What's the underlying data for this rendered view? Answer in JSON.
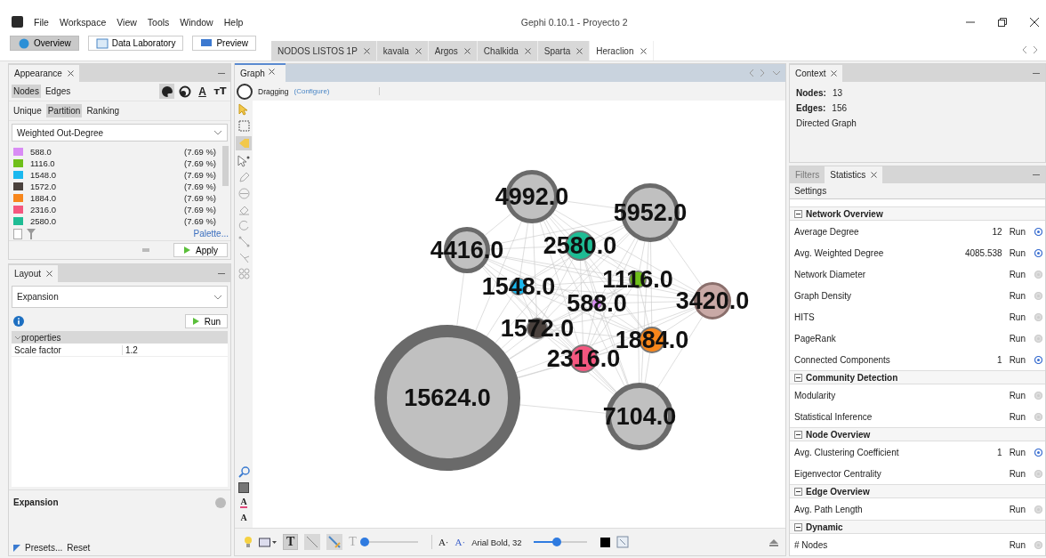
{
  "window": {
    "title": "Gephi 0.10.1 - Proyecto 2"
  },
  "menu": [
    "File",
    "Workspace",
    "View",
    "Tools",
    "Window",
    "Help"
  ],
  "perspectives": [
    {
      "label": "Overview",
      "selected": true
    },
    {
      "label": "Data Laboratory",
      "selected": false
    },
    {
      "label": "Preview",
      "selected": false
    }
  ],
  "workspaces": [
    {
      "label": "NODOS LISTOS 1P",
      "selected": false
    },
    {
      "label": "kavala",
      "selected": false
    },
    {
      "label": "Argos",
      "selected": false
    },
    {
      "label": "Chalkida",
      "selected": false
    },
    {
      "label": "Sparta",
      "selected": false
    },
    {
      "label": "Heraclion",
      "selected": true
    }
  ],
  "appearance": {
    "title": "Appearance",
    "element_tabs": [
      {
        "label": "Nodes",
        "selected": true
      },
      {
        "label": "Edges",
        "selected": false
      }
    ],
    "mode_tabs": [
      {
        "kind": "color",
        "selected": true
      },
      {
        "kind": "size",
        "selected": false
      },
      {
        "kind": "label_color",
        "label": "A",
        "selected": false
      },
      {
        "kind": "label_size",
        "label": "ᴛT",
        "selected": false
      }
    ],
    "method_tabs": [
      {
        "label": "Unique",
        "selected": false
      },
      {
        "label": "Partition",
        "selected": true
      },
      {
        "label": "Ranking",
        "selected": false
      }
    ],
    "attribute": "Weighted Out-Degree",
    "partitions": [
      {
        "value": "588.0",
        "share": "(7.69 %)",
        "color": "#d98cf5"
      },
      {
        "value": "1116.0",
        "share": "(7.69 %)",
        "color": "#6fbf1a"
      },
      {
        "value": "1548.0",
        "share": "(7.69 %)",
        "color": "#1ab8ef"
      },
      {
        "value": "1572.0",
        "share": "(7.69 %)",
        "color": "#4a413d"
      },
      {
        "value": "1884.0",
        "share": "(7.69 %)",
        "color": "#f7861b"
      },
      {
        "value": "2316.0",
        "share": "(7.69 %)",
        "color": "#f4577f"
      },
      {
        "value": "2580.0",
        "share": "(7.69 %)",
        "color": "#1ebc94"
      }
    ],
    "palette_link": "Palette...",
    "apply": "Apply"
  },
  "layout": {
    "title": "Layout",
    "algorithm": "Expansion",
    "run": "Run",
    "group": "properties",
    "properties": [
      {
        "name": "Scale factor",
        "value": "1.2"
      }
    ],
    "description_title": "Expansion",
    "presets": "Presets...",
    "reset": "Reset"
  },
  "graph": {
    "title": "Graph",
    "mode": "Dragging",
    "configure": "(Configure)",
    "label_tools": [
      "A",
      "A"
    ],
    "nodes": [
      {
        "label": "4992.0",
        "color": "#c0c0c0"
      },
      {
        "label": "5952.0",
        "color": "#c0c0c0"
      },
      {
        "label": "4416.0",
        "color": "#c0c0c0"
      },
      {
        "label": "2580.0",
        "color": "#1ebc94"
      },
      {
        "label": "1116.0",
        "color": "#6fbf1a"
      },
      {
        "label": "1548.0",
        "color": "#1ab8ef"
      },
      {
        "label": "3420.0",
        "color": "#c9a9a6"
      },
      {
        "label": "588.0",
        "color": "#d98cf5"
      },
      {
        "label": "1572.0",
        "color": "#4a413d"
      },
      {
        "label": "1884.0",
        "color": "#f7861b"
      },
      {
        "label": "2316.0",
        "color": "#f4577f"
      },
      {
        "label": "15624.0",
        "color": "#c0c0c0"
      },
      {
        "label": "7104.0",
        "color": "#c0c0c0"
      }
    ],
    "toolbar": {
      "show_labels": {
        "text": "T",
        "on": true
      },
      "outline_label": "T",
      "node_size_slider": {
        "level": 0.03
      },
      "font_buttons": [
        "A·",
        "A·"
      ],
      "font": "Arial Bold, 32",
      "label_size_slider": {
        "level": 0.44
      }
    }
  },
  "context": {
    "title": "Context",
    "nodes_label": "Nodes:",
    "nodes": "13",
    "edges_label": "Edges:",
    "edges": "156",
    "type": "Directed Graph"
  },
  "statistics": {
    "tabs": [
      {
        "label": "Filters",
        "selected": false
      },
      {
        "label": "Statistics",
        "selected": true
      }
    ],
    "settings": "Settings",
    "sections": [
      {
        "title": "Network Overview",
        "rows": [
          {
            "name": "Average Degree",
            "value": "12",
            "action": "Run",
            "computed": true
          },
          {
            "name": "Avg. Weighted Degree",
            "value": "4085.538",
            "action": "Run",
            "computed": true
          },
          {
            "name": "Network Diameter",
            "action": "Run",
            "computed": false
          },
          {
            "name": "Graph Density",
            "action": "Run",
            "computed": false
          },
          {
            "name": "HITS",
            "action": "Run",
            "computed": false
          },
          {
            "name": "PageRank",
            "action": "Run",
            "computed": false
          },
          {
            "name": "Connected Components",
            "value": "1",
            "action": "Run",
            "computed": true
          }
        ]
      },
      {
        "title": "Community Detection",
        "rows": [
          {
            "name": "Modularity",
            "action": "Run",
            "computed": false
          },
          {
            "name": "Statistical Inference",
            "action": "Run",
            "computed": false
          }
        ]
      },
      {
        "title": "Node Overview",
        "rows": [
          {
            "name": "Avg. Clustering Coefficient",
            "value": "1",
            "action": "Run",
            "computed": true
          },
          {
            "name": "Eigenvector Centrality",
            "action": "Run",
            "computed": false
          }
        ]
      },
      {
        "title": "Edge Overview",
        "rows": [
          {
            "name": "Avg. Path Length",
            "action": "Run",
            "computed": false
          }
        ]
      },
      {
        "title": "Dynamic",
        "rows": [
          {
            "name": "# Nodes",
            "action": "Run",
            "computed": false
          }
        ]
      }
    ]
  }
}
